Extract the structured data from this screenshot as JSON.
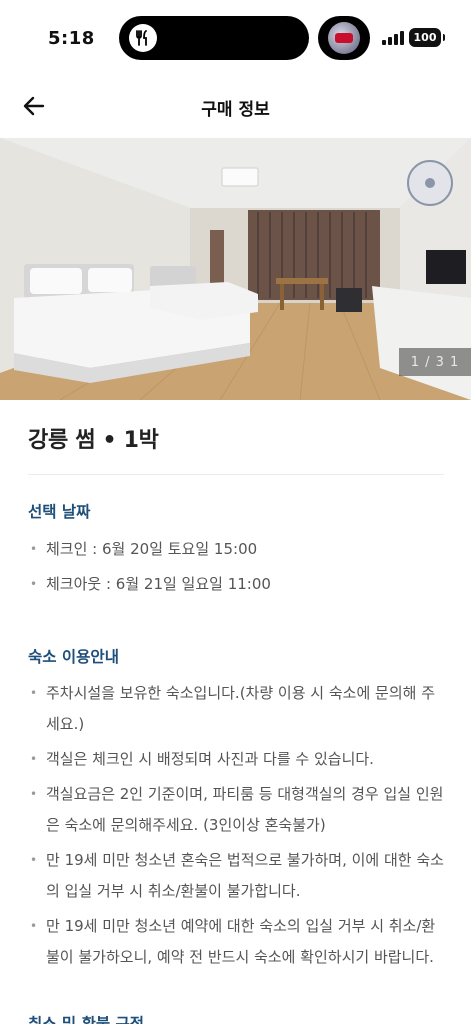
{
  "status_bar": {
    "time": "5:18",
    "battery": "100",
    "island_icon": "utensils-icon"
  },
  "header": {
    "title": "구매 정보",
    "back_icon": "arrow-left-icon"
  },
  "hero": {
    "photo_counter": "1 / 3 1"
  },
  "product": {
    "title": "강릉 썸 • 1박"
  },
  "dates": {
    "title": "선택 날짜",
    "items": [
      "체크인 : 6월 20일 토요일 15:00",
      "체크아웃 : 6월 21일 일요일 11:00"
    ]
  },
  "info": {
    "title": "숙소 이용안내",
    "items": [
      "주차시설을 보유한 숙소입니다.(차량 이용 시 숙소에 문의해 주세요.)",
      "객실은 체크인 시 배정되며 사진과 다를 수 있습니다.",
      "객실요금은 2인 기준이며, 파티룸 등 대형객실의 경우 입실 인원은 숙소에 문의해주세요. (3인이상 혼숙불가)",
      "만 19세 미만 청소년 혼숙은 법적으로 불가하며, 이에 대한 숙소의 입실 거부 시 취소/환불이 불가합니다.",
      "만 19세 미만 청소년 예약에 대한 숙소의 입실 거부 시 취소/환불이 불가하오니, 예약 전 반드시 숙소에 확인하시기 바랍니다."
    ]
  },
  "refund": {
    "title": "취소 및 환불 규정"
  },
  "colors": {
    "section_title": "#1e4f7a",
    "body_text": "#555555"
  }
}
